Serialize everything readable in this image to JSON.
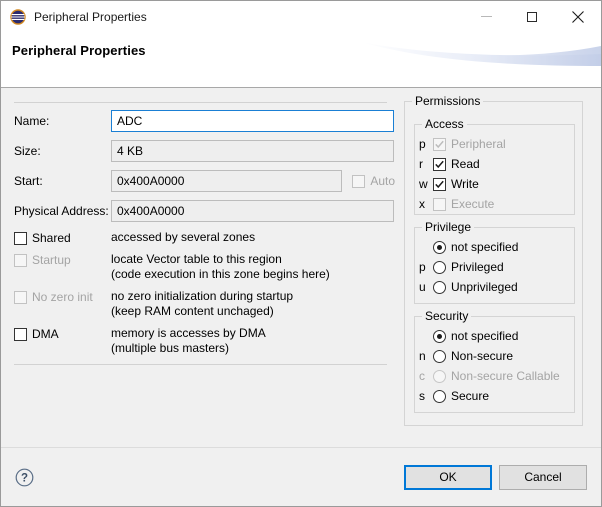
{
  "window": {
    "title": "Peripheral Properties",
    "icon": "eclipse-globe-icon",
    "controls": {
      "minimize": "minimize-icon",
      "maximize": "maximize-icon",
      "close": "close-icon"
    }
  },
  "header": {
    "title": "Peripheral Properties"
  },
  "form": {
    "name": {
      "label": "Name:",
      "value": "ADC"
    },
    "size": {
      "label": "Size:",
      "value": "4 KB"
    },
    "start": {
      "label": "Start:",
      "value": "0x400A0000"
    },
    "auto": {
      "label": "Auto",
      "checked": false,
      "enabled": false
    },
    "physical_address": {
      "label": "Physical Address:",
      "value": "0x400A0000"
    }
  },
  "options": [
    {
      "label": "Shared",
      "checked": false,
      "enabled": true,
      "desc1": "accessed by several zones",
      "desc2": ""
    },
    {
      "label": "Startup",
      "checked": false,
      "enabled": false,
      "desc1": "locate Vector table to this region",
      "desc2": "(code execution in this zone begins here)"
    },
    {
      "label": "No zero init",
      "checked": false,
      "enabled": false,
      "desc1": "no zero initialization during startup",
      "desc2": "(keep RAM content unchaged)"
    },
    {
      "label": "DMA",
      "checked": false,
      "enabled": true,
      "desc1": "memory is accesses by DMA",
      "desc2": "(multiple bus masters)"
    }
  ],
  "permissions": {
    "title": "Permissions",
    "access": {
      "title": "Access",
      "items": [
        {
          "prefix": "p",
          "label": "Peripheral",
          "checked": true,
          "enabled": false,
          "prefix_enabled": true
        },
        {
          "prefix": "r",
          "label": "Read",
          "checked": true,
          "enabled": true,
          "prefix_enabled": true
        },
        {
          "prefix": "w",
          "label": "Write",
          "checked": true,
          "enabled": true,
          "prefix_enabled": true
        },
        {
          "prefix": "x",
          "label": "Execute",
          "checked": false,
          "enabled": false,
          "prefix_enabled": true
        }
      ]
    },
    "privilege": {
      "title": "Privilege",
      "items": [
        {
          "prefix": "",
          "label": "not specified",
          "selected": true,
          "enabled": true,
          "prefix_enabled": true
        },
        {
          "prefix": "p",
          "label": "Privileged",
          "selected": false,
          "enabled": true,
          "prefix_enabled": true
        },
        {
          "prefix": "u",
          "label": "Unprivileged",
          "selected": false,
          "enabled": true,
          "prefix_enabled": true
        }
      ]
    },
    "security": {
      "title": "Security",
      "items": [
        {
          "prefix": "",
          "label": "not specified",
          "selected": true,
          "enabled": true,
          "prefix_enabled": true
        },
        {
          "prefix": "n",
          "label": "Non-secure",
          "selected": false,
          "enabled": true,
          "prefix_enabled": true
        },
        {
          "prefix": "c",
          "label": "Non-secure Callable",
          "selected": false,
          "enabled": false,
          "prefix_enabled": false
        },
        {
          "prefix": "s",
          "label": "Secure",
          "selected": false,
          "enabled": true,
          "prefix_enabled": true
        }
      ]
    }
  },
  "footer": {
    "help": "help-icon",
    "ok": "OK",
    "cancel": "Cancel"
  },
  "colors": {
    "accent": "#0078d7",
    "focus_border": "#1a7fd4",
    "body_bg": "#f0f0f0",
    "disabled_text": "#a4a4a4"
  }
}
